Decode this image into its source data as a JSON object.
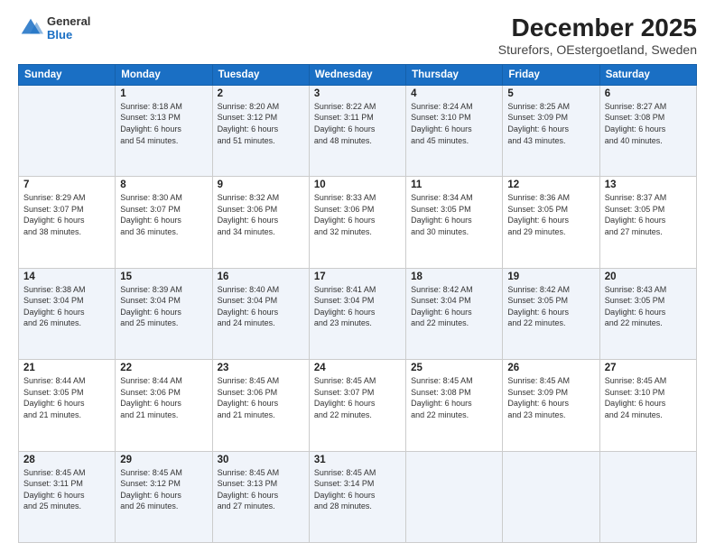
{
  "header": {
    "logo_general": "General",
    "logo_blue": "Blue",
    "title": "December 2025",
    "subtitle": "Sturefors, OEstergoetland, Sweden"
  },
  "days_of_week": [
    "Sunday",
    "Monday",
    "Tuesday",
    "Wednesday",
    "Thursday",
    "Friday",
    "Saturday"
  ],
  "weeks": [
    [
      {
        "day": "",
        "info": ""
      },
      {
        "day": "1",
        "info": "Sunrise: 8:18 AM\nSunset: 3:13 PM\nDaylight: 6 hours\nand 54 minutes."
      },
      {
        "day": "2",
        "info": "Sunrise: 8:20 AM\nSunset: 3:12 PM\nDaylight: 6 hours\nand 51 minutes."
      },
      {
        "day": "3",
        "info": "Sunrise: 8:22 AM\nSunset: 3:11 PM\nDaylight: 6 hours\nand 48 minutes."
      },
      {
        "day": "4",
        "info": "Sunrise: 8:24 AM\nSunset: 3:10 PM\nDaylight: 6 hours\nand 45 minutes."
      },
      {
        "day": "5",
        "info": "Sunrise: 8:25 AM\nSunset: 3:09 PM\nDaylight: 6 hours\nand 43 minutes."
      },
      {
        "day": "6",
        "info": "Sunrise: 8:27 AM\nSunset: 3:08 PM\nDaylight: 6 hours\nand 40 minutes."
      }
    ],
    [
      {
        "day": "7",
        "info": "Sunrise: 8:29 AM\nSunset: 3:07 PM\nDaylight: 6 hours\nand 38 minutes."
      },
      {
        "day": "8",
        "info": "Sunrise: 8:30 AM\nSunset: 3:07 PM\nDaylight: 6 hours\nand 36 minutes."
      },
      {
        "day": "9",
        "info": "Sunrise: 8:32 AM\nSunset: 3:06 PM\nDaylight: 6 hours\nand 34 minutes."
      },
      {
        "day": "10",
        "info": "Sunrise: 8:33 AM\nSunset: 3:06 PM\nDaylight: 6 hours\nand 32 minutes."
      },
      {
        "day": "11",
        "info": "Sunrise: 8:34 AM\nSunset: 3:05 PM\nDaylight: 6 hours\nand 30 minutes."
      },
      {
        "day": "12",
        "info": "Sunrise: 8:36 AM\nSunset: 3:05 PM\nDaylight: 6 hours\nand 29 minutes."
      },
      {
        "day": "13",
        "info": "Sunrise: 8:37 AM\nSunset: 3:05 PM\nDaylight: 6 hours\nand 27 minutes."
      }
    ],
    [
      {
        "day": "14",
        "info": "Sunrise: 8:38 AM\nSunset: 3:04 PM\nDaylight: 6 hours\nand 26 minutes."
      },
      {
        "day": "15",
        "info": "Sunrise: 8:39 AM\nSunset: 3:04 PM\nDaylight: 6 hours\nand 25 minutes."
      },
      {
        "day": "16",
        "info": "Sunrise: 8:40 AM\nSunset: 3:04 PM\nDaylight: 6 hours\nand 24 minutes."
      },
      {
        "day": "17",
        "info": "Sunrise: 8:41 AM\nSunset: 3:04 PM\nDaylight: 6 hours\nand 23 minutes."
      },
      {
        "day": "18",
        "info": "Sunrise: 8:42 AM\nSunset: 3:04 PM\nDaylight: 6 hours\nand 22 minutes."
      },
      {
        "day": "19",
        "info": "Sunrise: 8:42 AM\nSunset: 3:05 PM\nDaylight: 6 hours\nand 22 minutes."
      },
      {
        "day": "20",
        "info": "Sunrise: 8:43 AM\nSunset: 3:05 PM\nDaylight: 6 hours\nand 22 minutes."
      }
    ],
    [
      {
        "day": "21",
        "info": "Sunrise: 8:44 AM\nSunset: 3:05 PM\nDaylight: 6 hours\nand 21 minutes."
      },
      {
        "day": "22",
        "info": "Sunrise: 8:44 AM\nSunset: 3:06 PM\nDaylight: 6 hours\nand 21 minutes."
      },
      {
        "day": "23",
        "info": "Sunrise: 8:45 AM\nSunset: 3:06 PM\nDaylight: 6 hours\nand 21 minutes."
      },
      {
        "day": "24",
        "info": "Sunrise: 8:45 AM\nSunset: 3:07 PM\nDaylight: 6 hours\nand 22 minutes."
      },
      {
        "day": "25",
        "info": "Sunrise: 8:45 AM\nSunset: 3:08 PM\nDaylight: 6 hours\nand 22 minutes."
      },
      {
        "day": "26",
        "info": "Sunrise: 8:45 AM\nSunset: 3:09 PM\nDaylight: 6 hours\nand 23 minutes."
      },
      {
        "day": "27",
        "info": "Sunrise: 8:45 AM\nSunset: 3:10 PM\nDaylight: 6 hours\nand 24 minutes."
      }
    ],
    [
      {
        "day": "28",
        "info": "Sunrise: 8:45 AM\nSunset: 3:11 PM\nDaylight: 6 hours\nand 25 minutes."
      },
      {
        "day": "29",
        "info": "Sunrise: 8:45 AM\nSunset: 3:12 PM\nDaylight: 6 hours\nand 26 minutes."
      },
      {
        "day": "30",
        "info": "Sunrise: 8:45 AM\nSunset: 3:13 PM\nDaylight: 6 hours\nand 27 minutes."
      },
      {
        "day": "31",
        "info": "Sunrise: 8:45 AM\nSunset: 3:14 PM\nDaylight: 6 hours\nand 28 minutes."
      },
      {
        "day": "",
        "info": ""
      },
      {
        "day": "",
        "info": ""
      },
      {
        "day": "",
        "info": ""
      }
    ]
  ]
}
